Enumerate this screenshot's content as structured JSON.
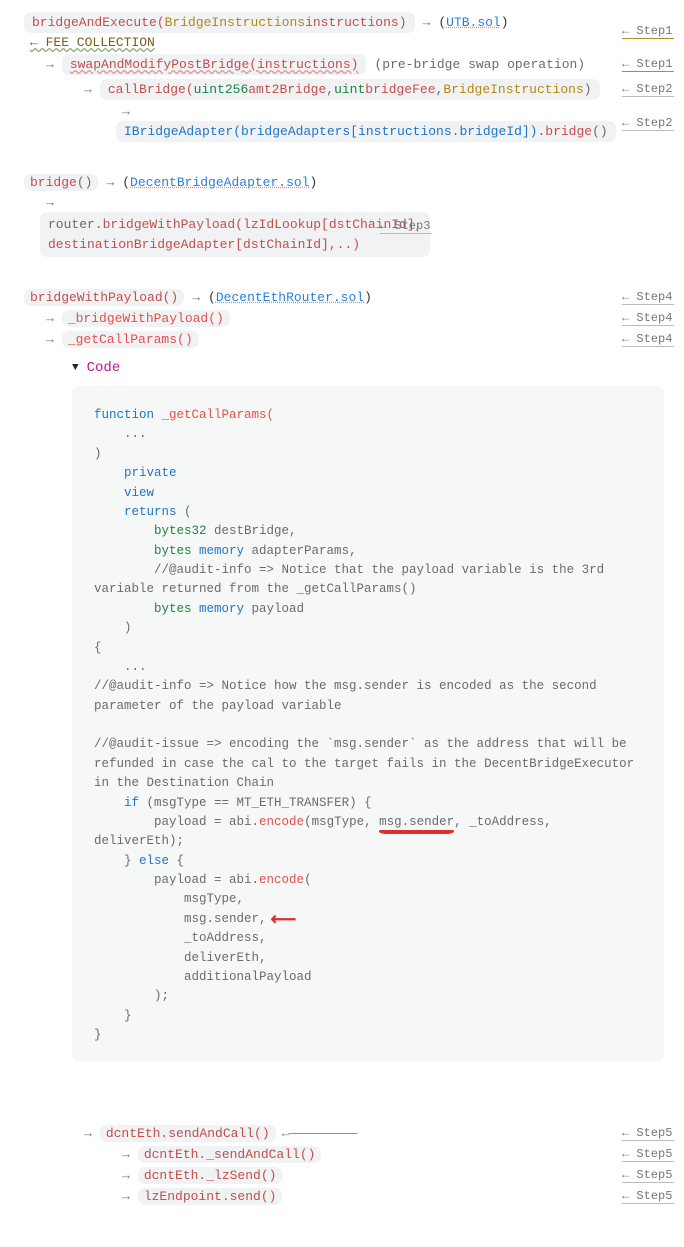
{
  "steps": {
    "s1": "← Step1",
    "s2": "← Step2",
    "s3": "← Step3",
    "s4": "← Step4",
    "s5": "← Step5"
  },
  "fee": "← FEE COLLECTION",
  "arrows": {
    "right": "→",
    "left": "←"
  },
  "section1": {
    "r0": {
      "fn": "bridgeAndExecute(",
      "argType": "BridgeInstructions ",
      "argName": "instructions",
      "close": ")",
      "file": "UTB.sol"
    },
    "r1": {
      "fn": "swapAndModifyPostBridge(instructions)",
      "note": "(pre-bridge swap operation)"
    },
    "r2": {
      "fn": "callBridge(",
      "t1": "uint256 ",
      "a1": "amt2Bridge",
      "sep1": ", ",
      "t2": "uint ",
      "a2": "bridgeFee",
      "sep2": ", ",
      "t3": "BridgeInstructions",
      "close": ")"
    },
    "r3": {
      "obj": "IBridgeAdapter(bridgeAdapters[instructions.bridgeId]).",
      "fn": "bridge",
      "paren": "()"
    }
  },
  "section2": {
    "r0": {
      "fn": "bridge",
      "paren": "()",
      "file": "DecentBridgeAdapter.sol"
    },
    "r1": {
      "obj": "router.",
      "fn": "bridgeWithPayload(lzIdLookup[dstChainId], destinationBridgeAdapter[dstChainId],..)"
    }
  },
  "section3": {
    "r0": {
      "fn": "bridgeWithPayload()",
      "file": "DecentEthRouter.sol"
    },
    "r1": {
      "fn": "_bridgeWithPayload()"
    },
    "r2": {
      "fn": "_getCallParams()"
    }
  },
  "toggle": {
    "arrow": "▼",
    "label": "Code"
  },
  "code": {
    "l01": "function",
    "l01b": " _getCallParams(",
    "l02": "    ...",
    "l03": ")",
    "l04": "    private",
    "l05": "    view",
    "l06a": "    returns",
    "l06b": " (",
    "l07a": "        bytes32",
    "l07b": " destBridge,",
    "l08a": "        bytes ",
    "l08b": "memory",
    "l08c": " adapterParams,",
    "l09": "        //@audit-info => Notice that the payload variable is the 3rd variable returned from the _getCallParams()",
    "l10a": "        bytes ",
    "l10b": "memory",
    "l10c": " payload",
    "l11": "    )",
    "l12": "{",
    "l13": "    ...",
    "l14": "//@audit-info => Notice how the msg.sender is encoded as the second parameter of the payload variable",
    "blank": " ",
    "l15": "//@audit-issue => encoding the `msg.sender` as the address that will be refunded in case the cal to the target fails in the DecentBridgeExecutor in the Destination Chain",
    "l16a": "    if",
    "l16b": " (msgType == MT_ETH_TRANSFER) {",
    "l17a": "        payload = abi.",
    "l17b": "encode",
    "l17c": "(msgType, ",
    "l17_mark": "msg.sender",
    "l17d": ", _toAddress, deliverEth);",
    "l18a": "    } ",
    "l18b": "else",
    "l18c": " {",
    "l19a": "        payload = abi.",
    "l19b": "encode",
    "l19c": "(",
    "l20": "            msgType,",
    "l21": "            msg.sender,",
    "l22": "            _toAddress,",
    "l23": "            deliverEth,",
    "l24": "            additionalPayload",
    "l25": "        );",
    "l26": "    }",
    "l27": "}"
  },
  "section5": {
    "longback": "←——————————",
    "r0": "dcntEth.sendAndCall()",
    "r1": "dcntEth._sendAndCall()",
    "r2": "dcntEth._lzSend()",
    "r3": "lzEndpoint.send()"
  }
}
